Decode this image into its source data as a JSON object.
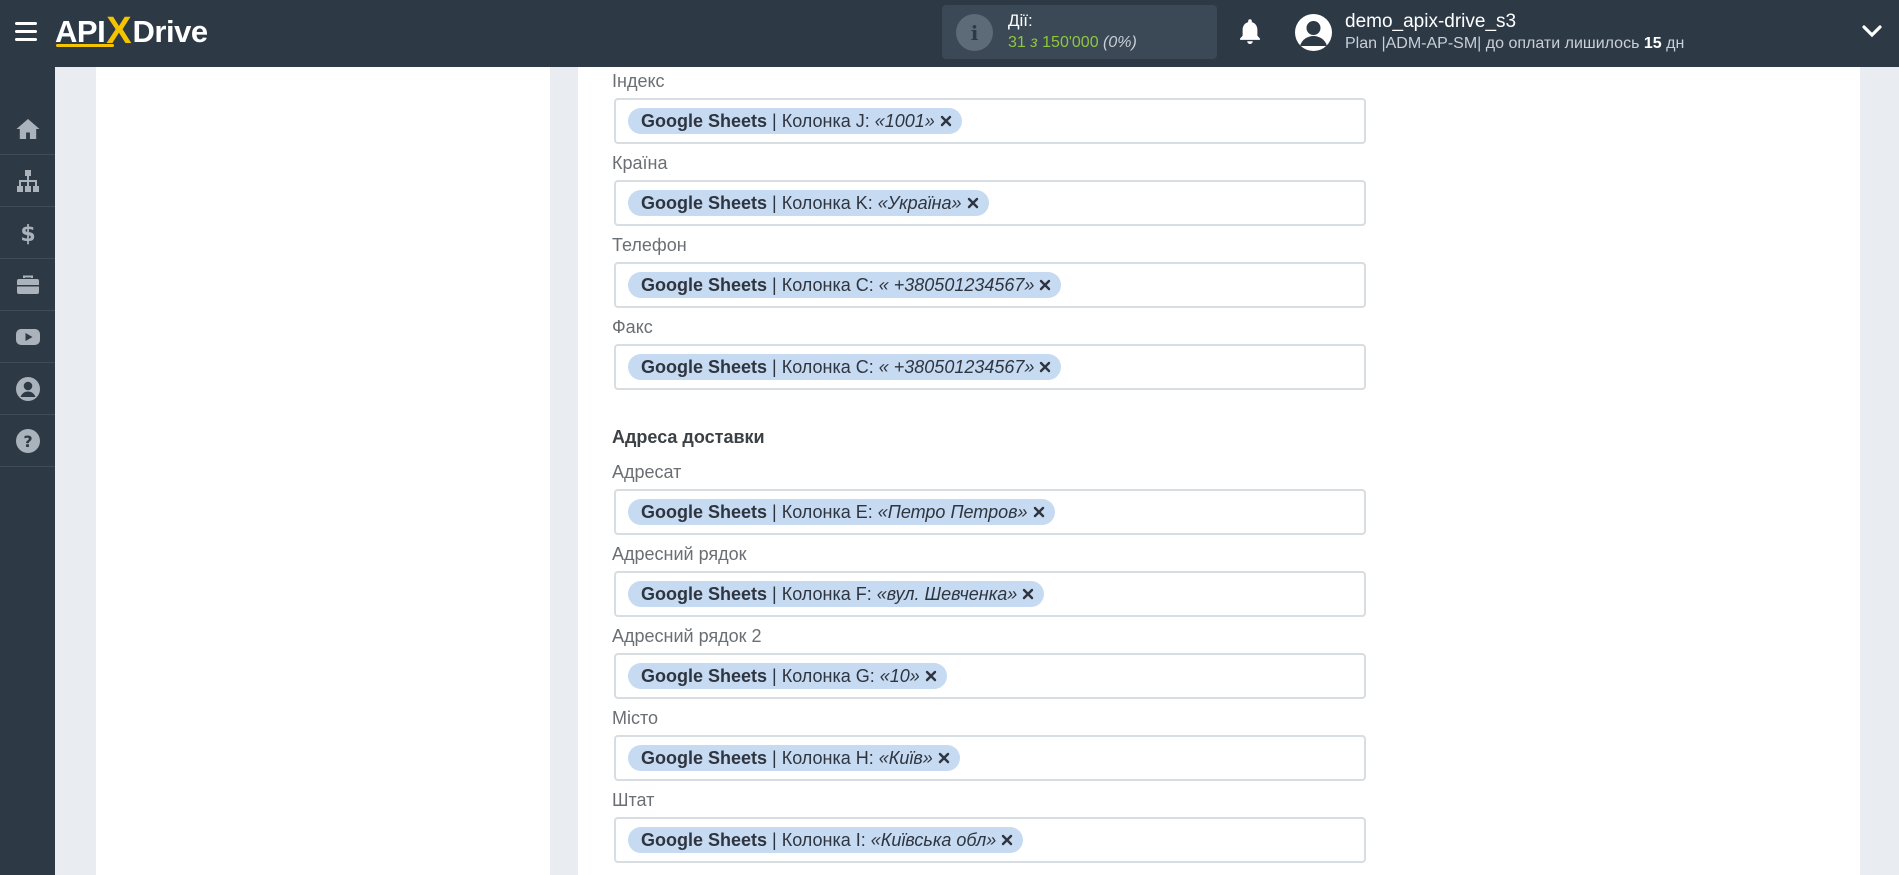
{
  "header": {
    "logo": {
      "part1": "API",
      "x": "X",
      "part2": "Drive"
    },
    "actions": {
      "label": "Дії:",
      "used": "31",
      "of": "з",
      "total": "150'000",
      "percent": "(0%)"
    },
    "user": {
      "name": "demo_apix-drive_s3",
      "plan_prefix": "Plan |ADM-AP-SM| до оплати лишилось",
      "days": "15",
      "days_unit": "дн"
    }
  },
  "sidebar": {
    "items": [
      {
        "icon": "home-icon"
      },
      {
        "icon": "sitemap-icon"
      },
      {
        "icon": "dollar-icon"
      },
      {
        "icon": "briefcase-icon"
      },
      {
        "icon": "youtube-icon"
      },
      {
        "icon": "user-circle-icon"
      },
      {
        "icon": "help-icon"
      }
    ]
  },
  "colors": {
    "topbar": "#2d3945",
    "accent": "#f5c400",
    "tag_bg": "#c6daf1",
    "actions_green": "#8ec63f"
  },
  "form": {
    "source": "Google Sheets",
    "fields": [
      {
        "label": "Індекс",
        "column": "| Колонка J:",
        "value": "«1001»"
      },
      {
        "label": "Країна",
        "column": "| Колонка K:",
        "value": "«Україна»"
      },
      {
        "label": "Телефон",
        "column": "| Колонка C:",
        "value": "« +380501234567»"
      },
      {
        "label": "Факс",
        "column": "| Колонка C:",
        "value": "« +380501234567»"
      }
    ],
    "shipping_title": "Адреса доставки",
    "shipping_fields": [
      {
        "label": "Адресат",
        "column": "| Колонка E:",
        "value": "«Петро Петров»"
      },
      {
        "label": "Адресний рядок",
        "column": "| Колонка F:",
        "value": "«вул. Шевченка»"
      },
      {
        "label": "Адресний рядок 2",
        "column": "| Колонка G:",
        "value": "«10»"
      },
      {
        "label": "Місто",
        "column": "| Колонка H:",
        "value": "«Київ»"
      },
      {
        "label": "Штат",
        "column": "| Колонка I:",
        "value": "«Київська обл»"
      }
    ]
  }
}
